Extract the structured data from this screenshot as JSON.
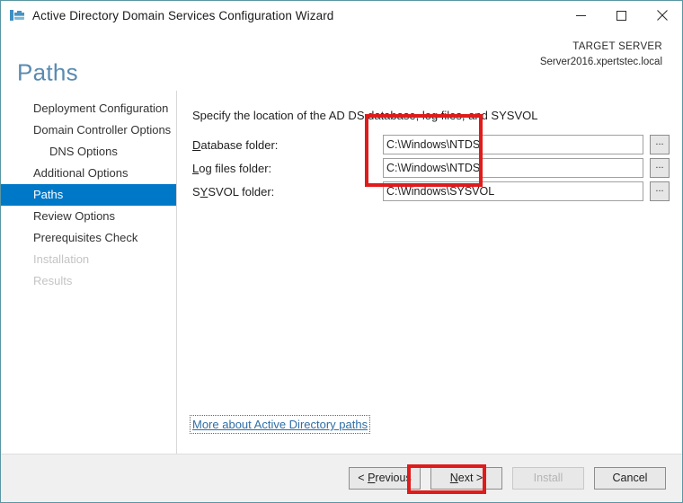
{
  "window": {
    "title": "Active Directory Domain Services Configuration Wizard",
    "icon": "ad-ds-server-icon",
    "border_color": "#5a96a3",
    "controls": {
      "minimize": "minimize-icon",
      "maximize": "maximize-icon",
      "close": "close-icon"
    }
  },
  "header": {
    "page_title": "Paths",
    "target_server_label": "TARGET SERVER",
    "target_server_name": "Server2016.xpertstec.local",
    "title_color": "#5a8bb0"
  },
  "sidebar": {
    "items": [
      {
        "label": "Deployment Configuration",
        "state": "normal",
        "indent": false
      },
      {
        "label": "Domain Controller Options",
        "state": "normal",
        "indent": false
      },
      {
        "label": "DNS Options",
        "state": "normal",
        "indent": true
      },
      {
        "label": "Additional Options",
        "state": "normal",
        "indent": false
      },
      {
        "label": "Paths",
        "state": "selected",
        "indent": false
      },
      {
        "label": "Review Options",
        "state": "normal",
        "indent": false
      },
      {
        "label": "Prerequisites Check",
        "state": "normal",
        "indent": false
      },
      {
        "label": "Installation",
        "state": "disabled",
        "indent": false
      },
      {
        "label": "Results",
        "state": "disabled",
        "indent": false
      }
    ],
    "selected_color": "#0078c8"
  },
  "main": {
    "instruction": "Specify the location of the AD DS database, log files, and SYSVOL",
    "fields": [
      {
        "label_pre": "",
        "label_accel": "D",
        "label_post": "atabase folder:",
        "value": "C:\\Windows\\NTDS",
        "browse": "..."
      },
      {
        "label_pre": "",
        "label_accel": "L",
        "label_post": "og files folder:",
        "value": "C:\\Windows\\NTDS",
        "browse": "..."
      },
      {
        "label_pre": "S",
        "label_accel": "Y",
        "label_post": "SVOL folder:",
        "value": "C:\\Windows\\SYSVOL",
        "browse": "..."
      }
    ],
    "more_link": "More about Active Directory paths"
  },
  "footer": {
    "previous_pre": "< ",
    "previous_accel": "P",
    "previous_post": "revious",
    "next_accel": "N",
    "next_post": "ext >",
    "install": "Install",
    "cancel": "Cancel"
  },
  "annotations": {
    "color": "#e01b1b",
    "field_box": "highlight-path-inputs",
    "next_box": "highlight-next-button"
  }
}
